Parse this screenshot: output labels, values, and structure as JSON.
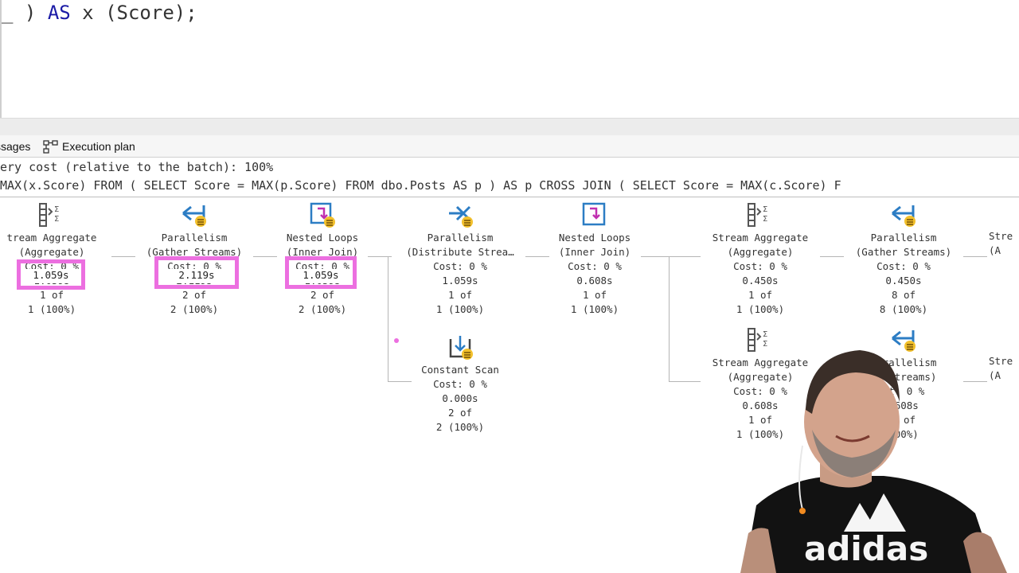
{
  "editor": {
    "code_prefix": "_",
    "code_paren": " ) ",
    "code_keyword": "AS",
    "code_rest": " x (Score);"
  },
  "tabs": {
    "messages": "ssages",
    "execution_plan": "Execution plan"
  },
  "header": {
    "line1": "ery cost (relative to the batch): 100%",
    "line2": "MAX(x.Score) FROM ( SELECT Score = MAX(p.Score) FROM dbo.Posts AS p ) AS p CROSS JOIN ( SELECT Score = MAX(c.Score) F"
  },
  "operators": [
    {
      "title": "tream Aggregate",
      "sub": "(Aggregate)",
      "cost": "Cost: 0 %",
      "time": "1.059s",
      "rows": "1 of",
      "pct": "1 (100%)",
      "icon": "stream-aggregate-icon"
    },
    {
      "title": "Parallelism",
      "sub": "(Gather Streams)",
      "cost": "Cost: 0 %",
      "time": "2.119s",
      "rows": "2 of",
      "pct": "2 (100%)",
      "icon": "parallelism-gather-icon"
    },
    {
      "title": "Nested Loops",
      "sub": "(Inner Join)",
      "cost": "Cost: 0 %",
      "time": "1.059s",
      "rows": "2 of",
      "pct": "2 (100%)",
      "icon": "nested-loops-icon"
    },
    {
      "title": "Parallelism",
      "sub": "(Distribute Strea…",
      "cost": "Cost: 0 %",
      "time": "1.059s",
      "rows": "1 of",
      "pct": "1 (100%)",
      "icon": "parallelism-distribute-icon"
    },
    {
      "title": "Nested Loops",
      "sub": "(Inner Join)",
      "cost": "Cost: 0 %",
      "time": "0.608s",
      "rows": "1 of",
      "pct": "1 (100%)",
      "icon": "nested-loops-icon"
    },
    {
      "title": "Stream Aggregate",
      "sub": "(Aggregate)",
      "cost": "Cost: 0 %",
      "time": "0.450s",
      "rows": "1 of",
      "pct": "1 (100%)",
      "icon": "stream-aggregate-icon"
    },
    {
      "title": "Parallelism",
      "sub": "(Gather Streams)",
      "cost": "Cost: 0 %",
      "time": "0.450s",
      "rows": "8 of",
      "pct": "8 (100%)",
      "icon": "parallelism-gather-icon"
    },
    {
      "title": "Constant Scan",
      "sub": "",
      "cost": "Cost: 0 %",
      "time": "0.000s",
      "rows": "2 of",
      "pct": "2 (100%)",
      "icon": "constant-scan-icon"
    },
    {
      "title": "Stream Aggregate",
      "sub": "(Aggregate)",
      "cost": "Cost: 0 %",
      "time": "0.608s",
      "rows": "1 of",
      "pct": "1 (100%)",
      "icon": "stream-aggregate-icon"
    },
    {
      "title": "Parallelism",
      "sub": "er Streams)",
      "cost": "st: 0 %",
      "time": ".608s",
      "rows": "8 of",
      "pct": "100%)",
      "icon": "parallelism-gather-icon"
    }
  ],
  "partial_ops": {
    "right_top_1": "Stre",
    "right_top_2": "(A",
    "right_bot_1": "Stre",
    "right_bot_2": "(A"
  },
  "highlights": [
    "1.059s",
    "2.119s",
    "1.059s"
  ],
  "colors": {
    "highlight": "#ec6fe0",
    "keyword": "#1a1aa6",
    "icon_blue": "#2c7dc4",
    "icon_yellow": "#f2c02c"
  },
  "webcam": {
    "shirt_text": "adidas"
  }
}
